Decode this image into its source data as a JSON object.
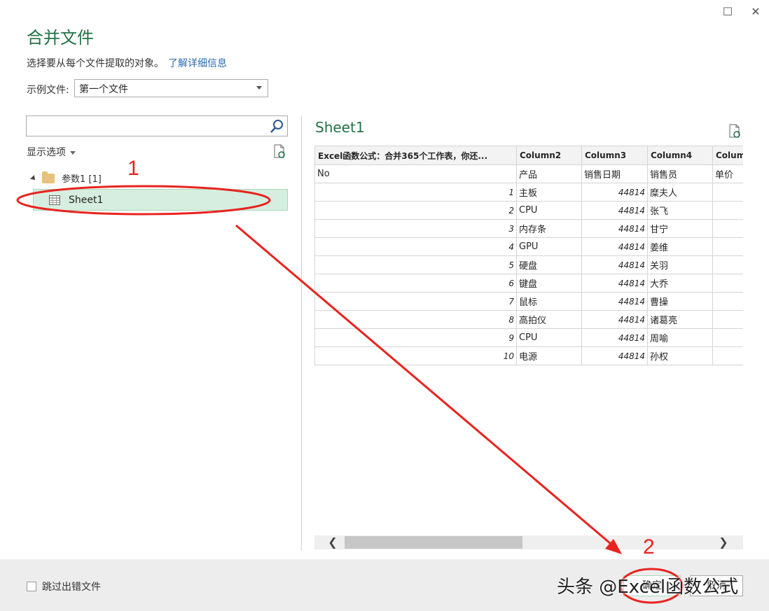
{
  "window": {
    "maximize_glyph": "☐",
    "close_glyph": "✕",
    "title": "合并文件",
    "subtitle": "选择要从每个文件提取的对象。",
    "learn_more": "了解详细信息"
  },
  "sample_file": {
    "label": "示例文件:",
    "value": "第一个文件"
  },
  "navigator": {
    "search_placeholder": "",
    "display_options": "显示选项",
    "parameter_node": "参数1 [1]",
    "sheet_node": "Sheet1"
  },
  "preview": {
    "title": "Sheet1",
    "columns": [
      "Excel函数公式：合并365个工作表，你还...",
      "Column2",
      "Column3",
      "Column4",
      "Colum"
    ],
    "rows": [
      [
        "No",
        "产品",
        "销售日期",
        "销售员",
        "单价"
      ],
      [
        "1",
        "主板",
        "44814",
        "糜夫人",
        ""
      ],
      [
        "2",
        "CPU",
        "44814",
        "张飞",
        ""
      ],
      [
        "3",
        "内存条",
        "44814",
        "甘宁",
        ""
      ],
      [
        "4",
        "GPU",
        "44814",
        "姜维",
        ""
      ],
      [
        "5",
        "硬盘",
        "44814",
        "关羽",
        ""
      ],
      [
        "6",
        "键盘",
        "44814",
        "大乔",
        ""
      ],
      [
        "7",
        "鼠标",
        "44814",
        "曹操",
        ""
      ],
      [
        "8",
        "高拍仪",
        "44814",
        "诸葛亮",
        ""
      ],
      [
        "9",
        "CPU",
        "44814",
        "周喻",
        ""
      ],
      [
        "10",
        "电源",
        "44814",
        "孙权",
        ""
      ]
    ],
    "scroll_left": "❮",
    "scroll_right": "❯"
  },
  "footer": {
    "skip_errors": "跳过出错文件",
    "ok": "确定",
    "cancel": "取消"
  },
  "annotations": {
    "step1": "1",
    "step2": "2",
    "watermark": "头条 @Excel函数公式",
    "color": "#e8231f"
  },
  "colors": {
    "accent": "#217346",
    "selected_bg": "#d6eedf",
    "link": "#2b6cb0"
  }
}
